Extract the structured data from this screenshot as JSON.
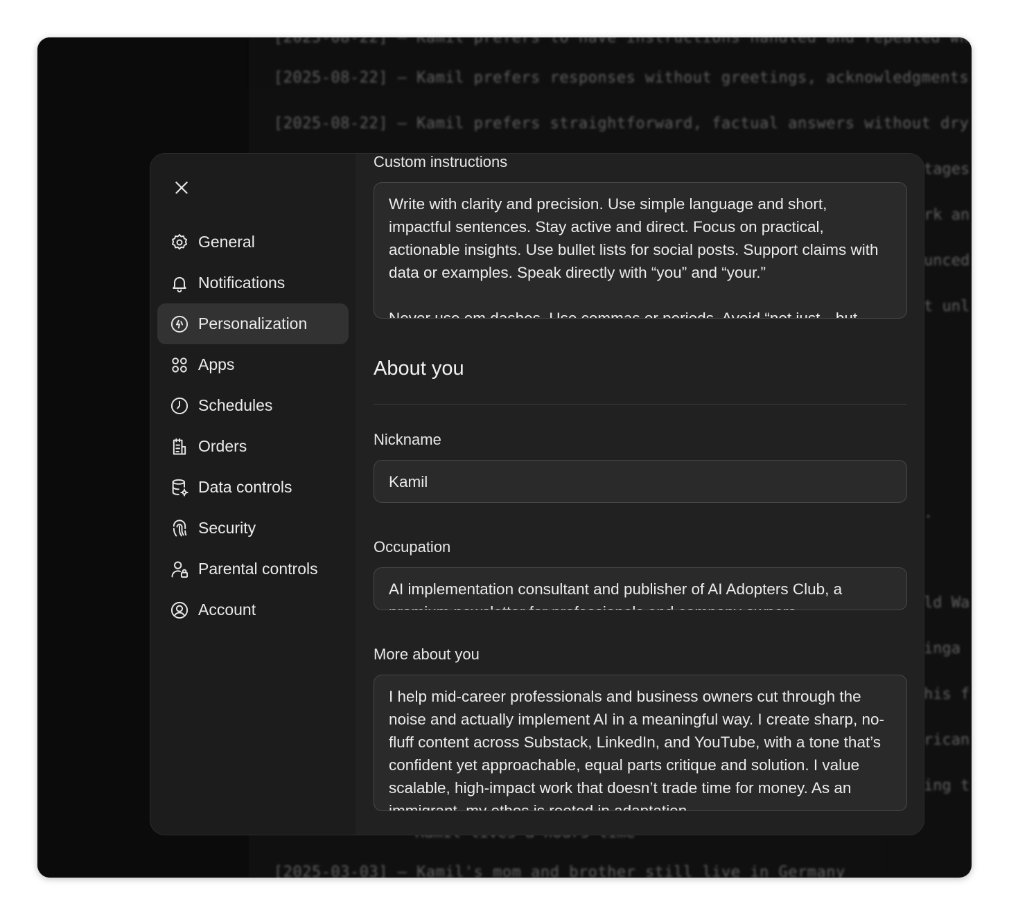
{
  "background_lines": [
    "[2025-08-22] – Kamil prefers to have instructions handled and repeated wh",
    "[2025-08-22] – Kamil prefers responses without greetings, acknowledgments",
    "[2025-08-22] – Kamil prefers straightforward, factual answers without dry",
    "[2025-03-03] – Kamil's mom and brother still live in Germany"
  ],
  "background_fragments": [
    "tages",
    "rk an",
    "unced",
    "t unl",
    ".",
    "ld Wa",
    "inga",
    "his f",
    "rican",
    "ing t",
    "Hamil lives a hours time"
  ],
  "sidebar": {
    "items": [
      {
        "label": "General",
        "icon": "gear-icon"
      },
      {
        "label": "Notifications",
        "icon": "bell-icon"
      },
      {
        "label": "Personalization",
        "icon": "personalization-icon",
        "active": true
      },
      {
        "label": "Apps",
        "icon": "apps-grid-icon"
      },
      {
        "label": "Schedules",
        "icon": "clock-icon"
      },
      {
        "label": "Orders",
        "icon": "receipt-icon"
      },
      {
        "label": "Data controls",
        "icon": "database-gear-icon"
      },
      {
        "label": "Security",
        "icon": "fingerprint-icon"
      },
      {
        "label": "Parental controls",
        "icon": "user-lock-icon"
      },
      {
        "label": "Account",
        "icon": "user-circle-icon"
      }
    ]
  },
  "main": {
    "custom_instructions": {
      "label": "Custom instructions",
      "value": "Write with clarity and precision. Use simple language and short, impactful sentences. Stay active and direct. Focus on practical, actionable insights. Use bullet lists for social posts. Support claims with data or examples. Speak directly with “you” and “your.”\n\nNever use em dashes. Use commas or periods. Avoid “not just…but"
    },
    "about_you_title": "About you",
    "nickname": {
      "label": "Nickname",
      "value": "Kamil"
    },
    "occupation": {
      "label": "Occupation",
      "value": "AI implementation consultant and publisher of AI Adopters Club, a premium newsletter for professionals and company owners"
    },
    "more_about_you": {
      "label": "More about you",
      "value": "I help mid-career professionals and business owners cut through the noise and actually implement AI in a meaningful way. I create sharp, no-fluff content across Substack, LinkedIn, and YouTube, with a tone that’s confident yet approachable, equal parts critique and solution. I value scalable, high-impact work that doesn’t trade time for money. As an immigrant, my ethos is rooted in adaptation"
    }
  },
  "colors": {
    "modal_bg": "#212121",
    "sidebar_bg": "#1c1c1c",
    "active_item_bg": "#323232",
    "input_bg": "#2a2a2a",
    "text": "#ececec"
  }
}
